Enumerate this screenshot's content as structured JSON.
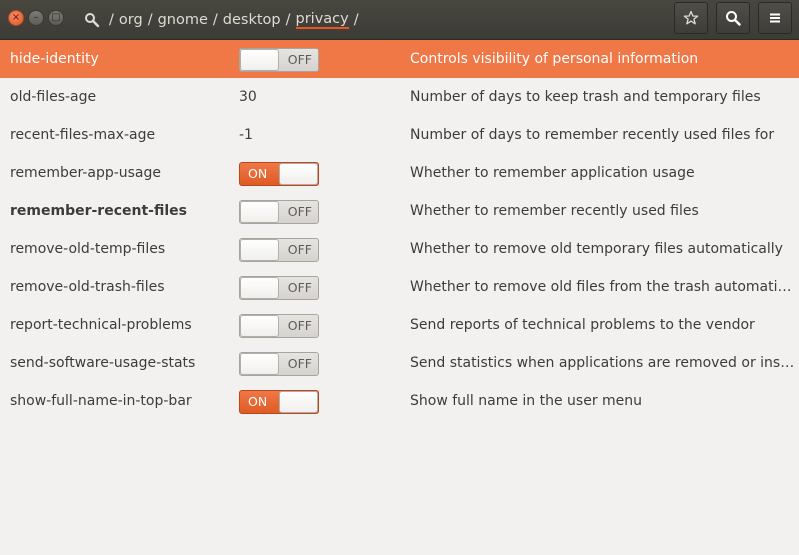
{
  "window": {
    "close_glyph": "×",
    "min_glyph": "–",
    "max_glyph": "□"
  },
  "path": {
    "segments": [
      "org",
      "gnome",
      "desktop",
      "privacy"
    ],
    "separator": "/"
  },
  "rows": [
    {
      "key": "hide-identity",
      "type": "switch",
      "state": "off",
      "state_label": "OFF",
      "description": "Controls visibility of personal information"
    },
    {
      "key": "old-files-age",
      "type": "value",
      "value": "30",
      "description": "Number of days to keep trash and temporary files"
    },
    {
      "key": "recent-files-max-age",
      "type": "value",
      "value": "-1",
      "description": "Number of days to remember recently used files for"
    },
    {
      "key": "remember-app-usage",
      "type": "switch",
      "state": "on",
      "state_label": "ON",
      "description": "Whether to remember application usage"
    },
    {
      "key": "remember-recent-files",
      "type": "switch",
      "state": "off",
      "state_label": "OFF",
      "description": "Whether to remember recently used files"
    },
    {
      "key": "remove-old-temp-files",
      "type": "switch",
      "state": "off",
      "state_label": "OFF",
      "description": "Whether to remove old temporary files automatically"
    },
    {
      "key": "remove-old-trash-files",
      "type": "switch",
      "state": "off",
      "state_label": "OFF",
      "description": "Whether to remove old files from the trash automatically"
    },
    {
      "key": "report-technical-problems",
      "type": "switch",
      "state": "off",
      "state_label": "OFF",
      "description": "Send reports of technical problems to the vendor"
    },
    {
      "key": "send-software-usage-stats",
      "type": "switch",
      "state": "off",
      "state_label": "OFF",
      "description": "Send statistics when applications are removed or instal…"
    },
    {
      "key": "show-full-name-in-top-bar",
      "type": "switch",
      "state": "on",
      "state_label": "ON",
      "description": "Show full name in the user menu"
    }
  ],
  "colors": {
    "accent": "#e95420",
    "selected_row": "#f07746",
    "titlebar": "#3c3b37"
  },
  "icons": {
    "root": "root-search-icon",
    "star": "star-icon",
    "search": "search-icon",
    "menu": "hamburger-menu-icon"
  }
}
